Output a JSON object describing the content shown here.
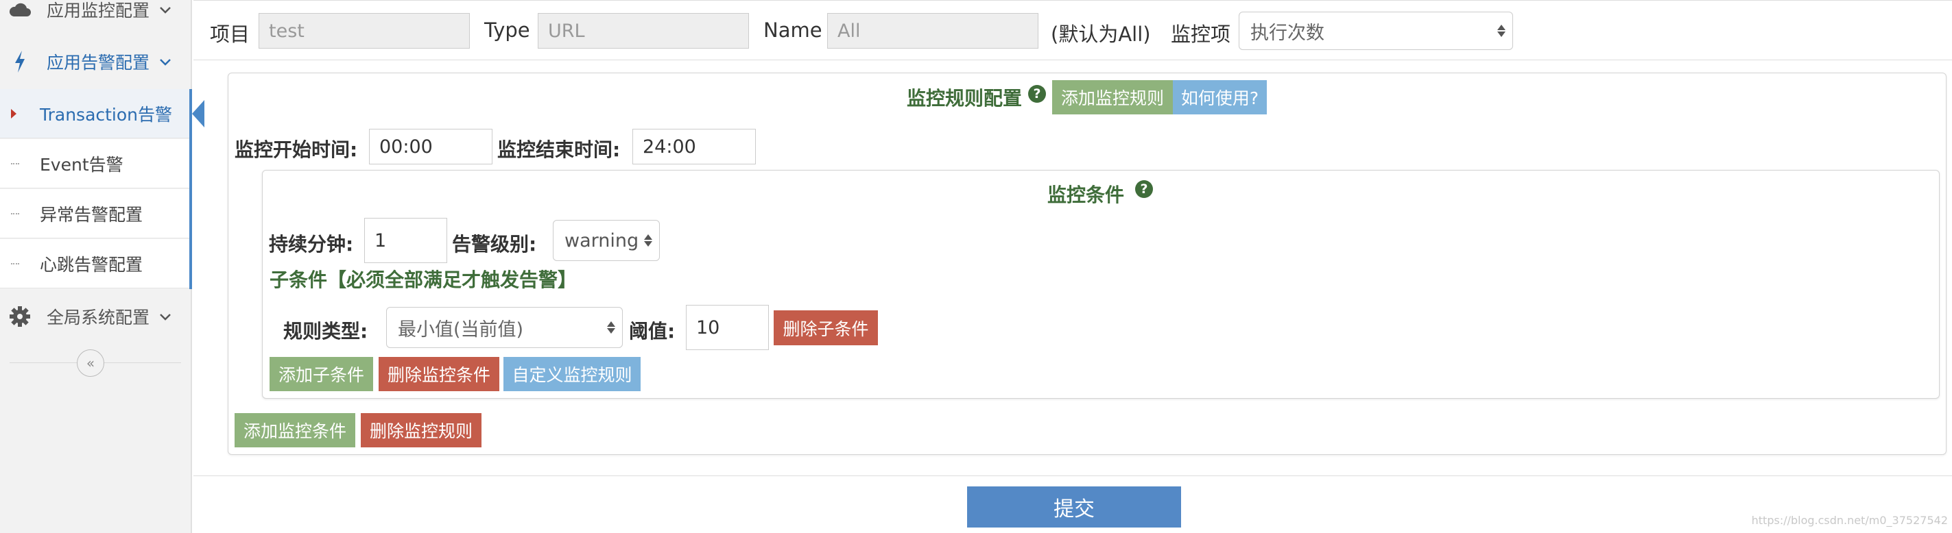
{
  "sidebar": {
    "groups": [
      {
        "label": "应用监控配置",
        "icon": "cloud-icon"
      },
      {
        "label": "应用告警配置",
        "icon": "lightning-icon"
      },
      {
        "label": "全局系统配置",
        "icon": "gear-icon"
      }
    ],
    "items": [
      {
        "label": "Transaction告警"
      },
      {
        "label": "Event告警"
      },
      {
        "label": "异常告警配置"
      },
      {
        "label": "心跳告警配置"
      }
    ],
    "collapse_glyph": "«"
  },
  "filter": {
    "project_label": "项目",
    "project_value": "test",
    "type_label": "Type",
    "type_value": "URL",
    "name_label": "Name",
    "name_value": "All",
    "name_hint": "(默认为All)",
    "metric_label": "监控项",
    "metric_value": "执行次数"
  },
  "rule": {
    "title": "监控规则配置",
    "add_rule_button": "添加监控规则",
    "how_to_button": "如何使用?",
    "start_label": "监控开始时间:",
    "start_value": "00:00",
    "end_label": "监控结束时间:",
    "end_value": "24:00",
    "add_condition_button": "添加监控条件",
    "delete_rule_button": "删除监控规则"
  },
  "condition": {
    "title": "监控条件",
    "duration_label": "持续分钟:",
    "duration_value": "1",
    "level_label": "告警级别:",
    "level_value": "warning",
    "subcondition_title": "子条件【必须全部满足才触发告警】",
    "rule_type_label": "规则类型:",
    "rule_type_value": "最小值(当前值)",
    "threshold_label": "阈值:",
    "threshold_value": "10",
    "delete_subcondition_button": "删除子条件",
    "add_subcondition_button": "添加子条件",
    "delete_condition_button": "删除监控条件",
    "custom_rule_button": "自定义监控规则"
  },
  "submit_label": "提交",
  "help_glyph": "?",
  "watermark": "https://blog.csdn.net/m0_37527542",
  "colors": {
    "accent_blue": "#2b6cb0",
    "green_button": "#8fb37c",
    "red_button": "#c45c4a",
    "blue_button": "#7eb3dc",
    "submit_button": "#5489c6",
    "title_green": "#3f6d3a"
  }
}
